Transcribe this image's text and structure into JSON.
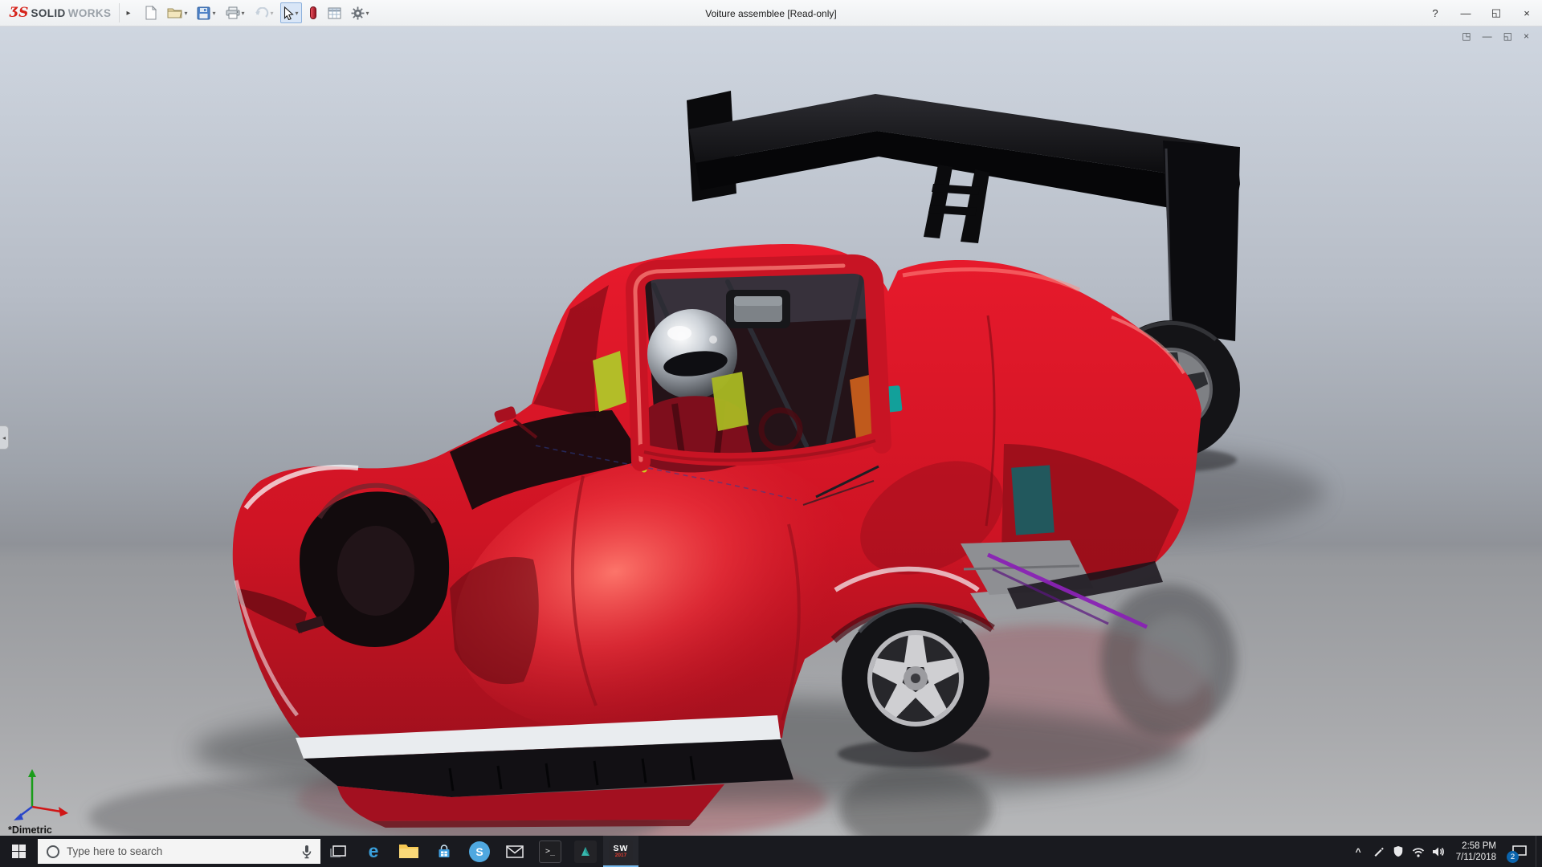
{
  "titlebar": {
    "brand": {
      "ds": "ƷS",
      "solid": "SOLID",
      "works": "WORKS"
    },
    "flyout": "▸",
    "title": "Voiture assemblee [Read-only]",
    "controls": {
      "help": "?",
      "minimize": "—",
      "maximize": "◱",
      "close": "×"
    }
  },
  "toolbar": {
    "caret": "▾",
    "icons": [
      {
        "name": "new-document"
      },
      {
        "name": "open"
      },
      {
        "name": "save"
      },
      {
        "name": "print"
      },
      {
        "name": "undo"
      },
      {
        "name": "select"
      },
      {
        "name": "rebuild"
      },
      {
        "name": "design-table"
      },
      {
        "name": "options"
      }
    ]
  },
  "viewport": {
    "view_label": "*Dimetric",
    "panel_tab_glyph": "◂",
    "doc_controls": [
      {
        "name": "dock",
        "glyph": "◳"
      },
      {
        "name": "minimize",
        "glyph": "—"
      },
      {
        "name": "restore",
        "glyph": "◱"
      },
      {
        "name": "close",
        "glyph": "×"
      }
    ]
  },
  "taskbar": {
    "search_placeholder": "Type here to search",
    "apps": [
      {
        "name": "task-view"
      },
      {
        "name": "edge",
        "glyph": "e"
      },
      {
        "name": "file-explorer"
      },
      {
        "name": "store"
      },
      {
        "name": "skype",
        "glyph": "S"
      },
      {
        "name": "mail"
      },
      {
        "name": "command-prompt",
        "glyph": ">_"
      },
      {
        "name": "edrawings"
      },
      {
        "name": "solidworks-2017",
        "glyph": "SW",
        "sub": "2017"
      }
    ],
    "tray": {
      "chevron": "^",
      "time": "2:58 PM",
      "date": "7/11/2018",
      "badge": "2"
    }
  },
  "colors": {
    "body_red": "#c81424",
    "accent_purple": "#8a22b5",
    "taskbar_bg": "#191a1f",
    "titlebar_bg": "#f0f0f0"
  }
}
